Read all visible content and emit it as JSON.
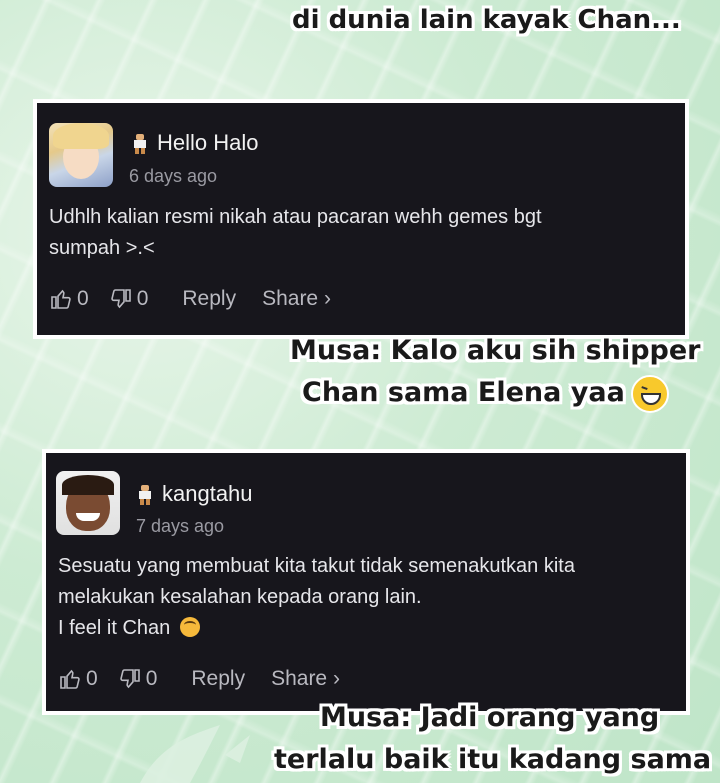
{
  "captions": {
    "top": "di dunia lain kayak Chan...",
    "middle_line1": "Musa: Kalo aku sih shipper",
    "middle_line2": "Chan sama Elena yaa",
    "bottom_line1": "Musa: Jadi orang yang",
    "bottom_line2": "terlalu baik itu kadang sama"
  },
  "comments": [
    {
      "username": "Hello Halo",
      "time": "6 days ago",
      "text_line1": "Udhlh kalian resmi nikah atau pacaran wehh gemes bgt",
      "text_line2": "sumpah >.<",
      "likes": "0",
      "dislikes": "0",
      "reply_label": "Reply",
      "share_label": "Share ›"
    },
    {
      "username": "kangtahu",
      "time": "7 days ago",
      "text_line1": "Sesuatu yang membuat kita takut tidak semenakutkan kita",
      "text_line2": "melakukan kesalahan kepada orang lain.",
      "text_line3": "I feel it Chan",
      "likes": "0",
      "dislikes": "0",
      "reply_label": "Reply",
      "share_label": "Share ›"
    }
  ],
  "colors": {
    "background": "#cdebd3",
    "card": "#17161c",
    "caption_text": "#1a1a1a"
  },
  "icons": [
    "rank-badge-icon",
    "thumbs-up-icon",
    "thumbs-down-icon",
    "grin-emoji-icon",
    "upside-down-emoji-icon"
  ]
}
